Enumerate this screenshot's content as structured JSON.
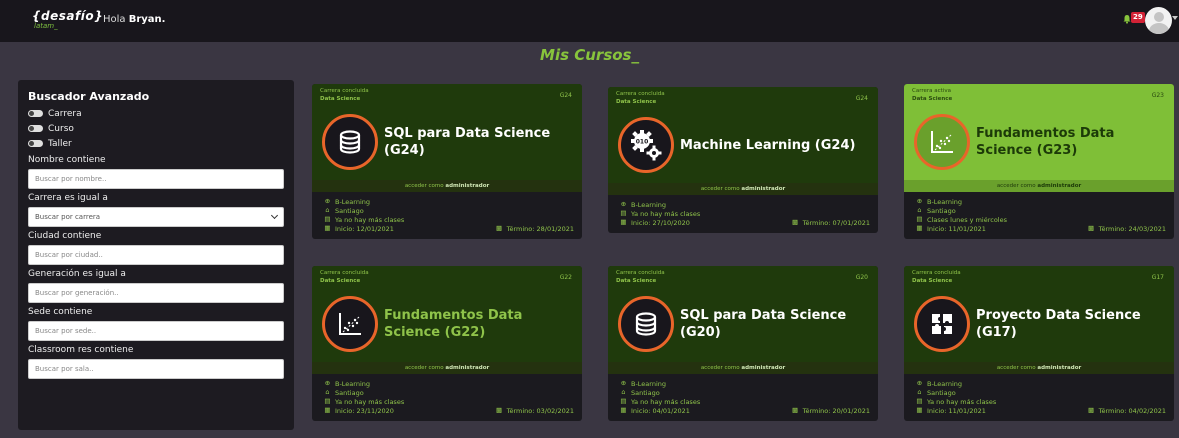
{
  "header": {
    "logo_main": "{desafío}",
    "logo_sub": "latam_",
    "greeting_prefix": "Hola ",
    "user_name": "Bryan.",
    "notification_count": "29"
  },
  "page_title": "Mis Cursos_",
  "sidebar": {
    "title": "Buscador Avanzado",
    "radios": [
      "Carrera",
      "Curso",
      "Taller"
    ],
    "fields": {
      "nombre_label": "Nombre contiene",
      "nombre_placeholder": "Buscar por nombre..",
      "carrera_label": "Carrera es igual a",
      "carrera_selected": "Buscar por carrera",
      "ciudad_label": "Ciudad contiene",
      "ciudad_placeholder": "Buscar por ciudad..",
      "generacion_label": "Generación es igual a",
      "generacion_placeholder": "Buscar por generación..",
      "sede_label": "Sede contiene",
      "sede_placeholder": "Buscar por sede..",
      "classroom_label": "Classroom res contiene",
      "classroom_placeholder": "Buscar por sala.."
    }
  },
  "admin_prefix": "acceder como ",
  "admin_role": "administrador",
  "cards": [
    {
      "status": "Carrera concluida",
      "category": "Data Science",
      "code": "G24",
      "title": "SQL para Data Science (G24)",
      "icon": "database-icon",
      "modality": "B-Learning",
      "city": "Santiago",
      "classes": "Ya no hay más clases",
      "start": "Inicio: 12/01/2021",
      "end": "Término: 28/01/2021"
    },
    {
      "status": "Carrera concluida",
      "category": "Data Science",
      "code": "G24",
      "title": "Machine Learning (G24)",
      "icon": "gears-icon",
      "modality": "B-Learning",
      "city": "",
      "classes": "Ya no hay más clases",
      "start": "Inicio: 27/10/2020",
      "end": "Término: 07/01/2021"
    },
    {
      "status": "Carrera activa",
      "category": "Data Science",
      "code": "G23",
      "title": "Fundamentos Data Science (G23)",
      "icon": "scatter-chart-icon",
      "modality": "B-Learning",
      "city": "Santiago",
      "classes": "Clases lunes y miércoles",
      "start": "Inicio: 11/01/2021",
      "end": "Término: 24/03/2021"
    },
    {
      "status": "Carrera concluida",
      "category": "Data Science",
      "code": "G22",
      "title": "Fundamentos Data Science (G22)",
      "icon": "scatter-chart-icon",
      "modality": "B-Learning",
      "city": "Santiago",
      "classes": "Ya no hay más clases",
      "start": "Inicio: 23/11/2020",
      "end": "Término: 03/02/2021"
    },
    {
      "status": "Carrera concluida",
      "category": "Data Science",
      "code": "G20",
      "title": "SQL para Data Science (G20)",
      "icon": "database-icon",
      "modality": "B-Learning",
      "city": "Santiago",
      "classes": "Ya no hay más clases",
      "start": "Inicio: 04/01/2021",
      "end": "Término: 20/01/2021"
    },
    {
      "status": "Carrera concluida",
      "category": "Data Science",
      "code": "G17",
      "title": "Proyecto Data Science (G17)",
      "icon": "puzzle-icon",
      "modality": "B-Learning",
      "city": "Santiago",
      "classes": "Ya no hay más clases",
      "start": "Inicio: 11/01/2021",
      "end": "Término: 04/02/2021"
    }
  ],
  "colors": {
    "accent_green": "#88c43c",
    "dark_green": "#1f3a0c",
    "active_green": "#7fbf37",
    "icon_ring": "#e8652a",
    "badge_red": "#d32236",
    "background": "#3a3642"
  }
}
